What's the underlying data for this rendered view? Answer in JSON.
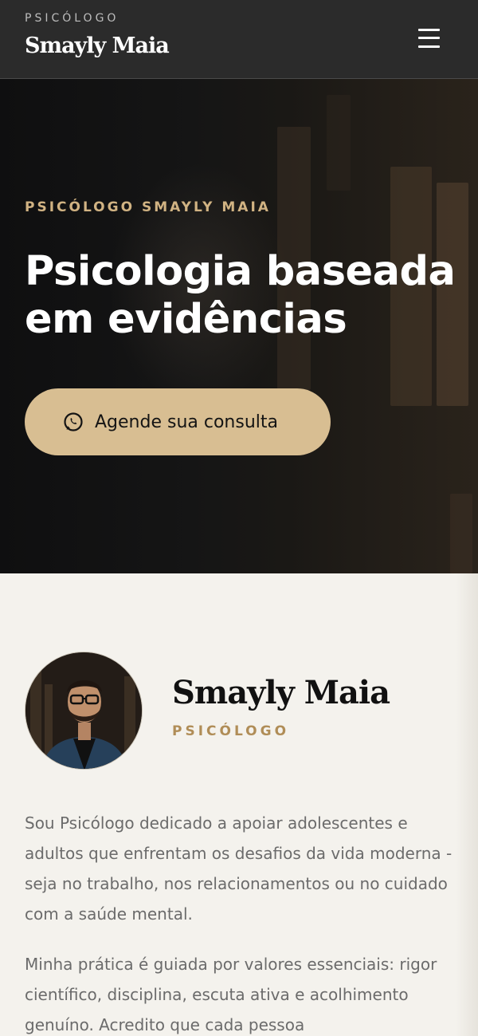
{
  "header": {
    "kicker": "PSICÓLOGO",
    "brand": "Smayly Maia",
    "menu_icon": "hamburger-menu-icon"
  },
  "hero": {
    "kicker": "PSICÓLOGO SMAYLY MAIA",
    "title": "Psicologia baseada em evidências",
    "cta_label": "Agende sua consulta",
    "cta_icon": "whatsapp-icon",
    "accent_color": "#d8be92"
  },
  "about": {
    "name": "Smayly Maia",
    "role": "PSICÓLOGO",
    "paragraphs": [
      "Sou Psicólogo dedicado a apoiar adolescentes e adultos que enfrentam os desafios da vida moderna - seja no trabalho, nos relacionamentos ou no cuidado com a saúde mental.",
      "Minha prática é guiada por valores essenciais: rigor científico, disciplina, escuta ativa e acolhimento genuíno. Acredito que cada pessoa"
    ]
  },
  "colors": {
    "header_bg": "#2b2b2b",
    "gold": "#b08d57",
    "page_bg": "#f4f2ed"
  }
}
